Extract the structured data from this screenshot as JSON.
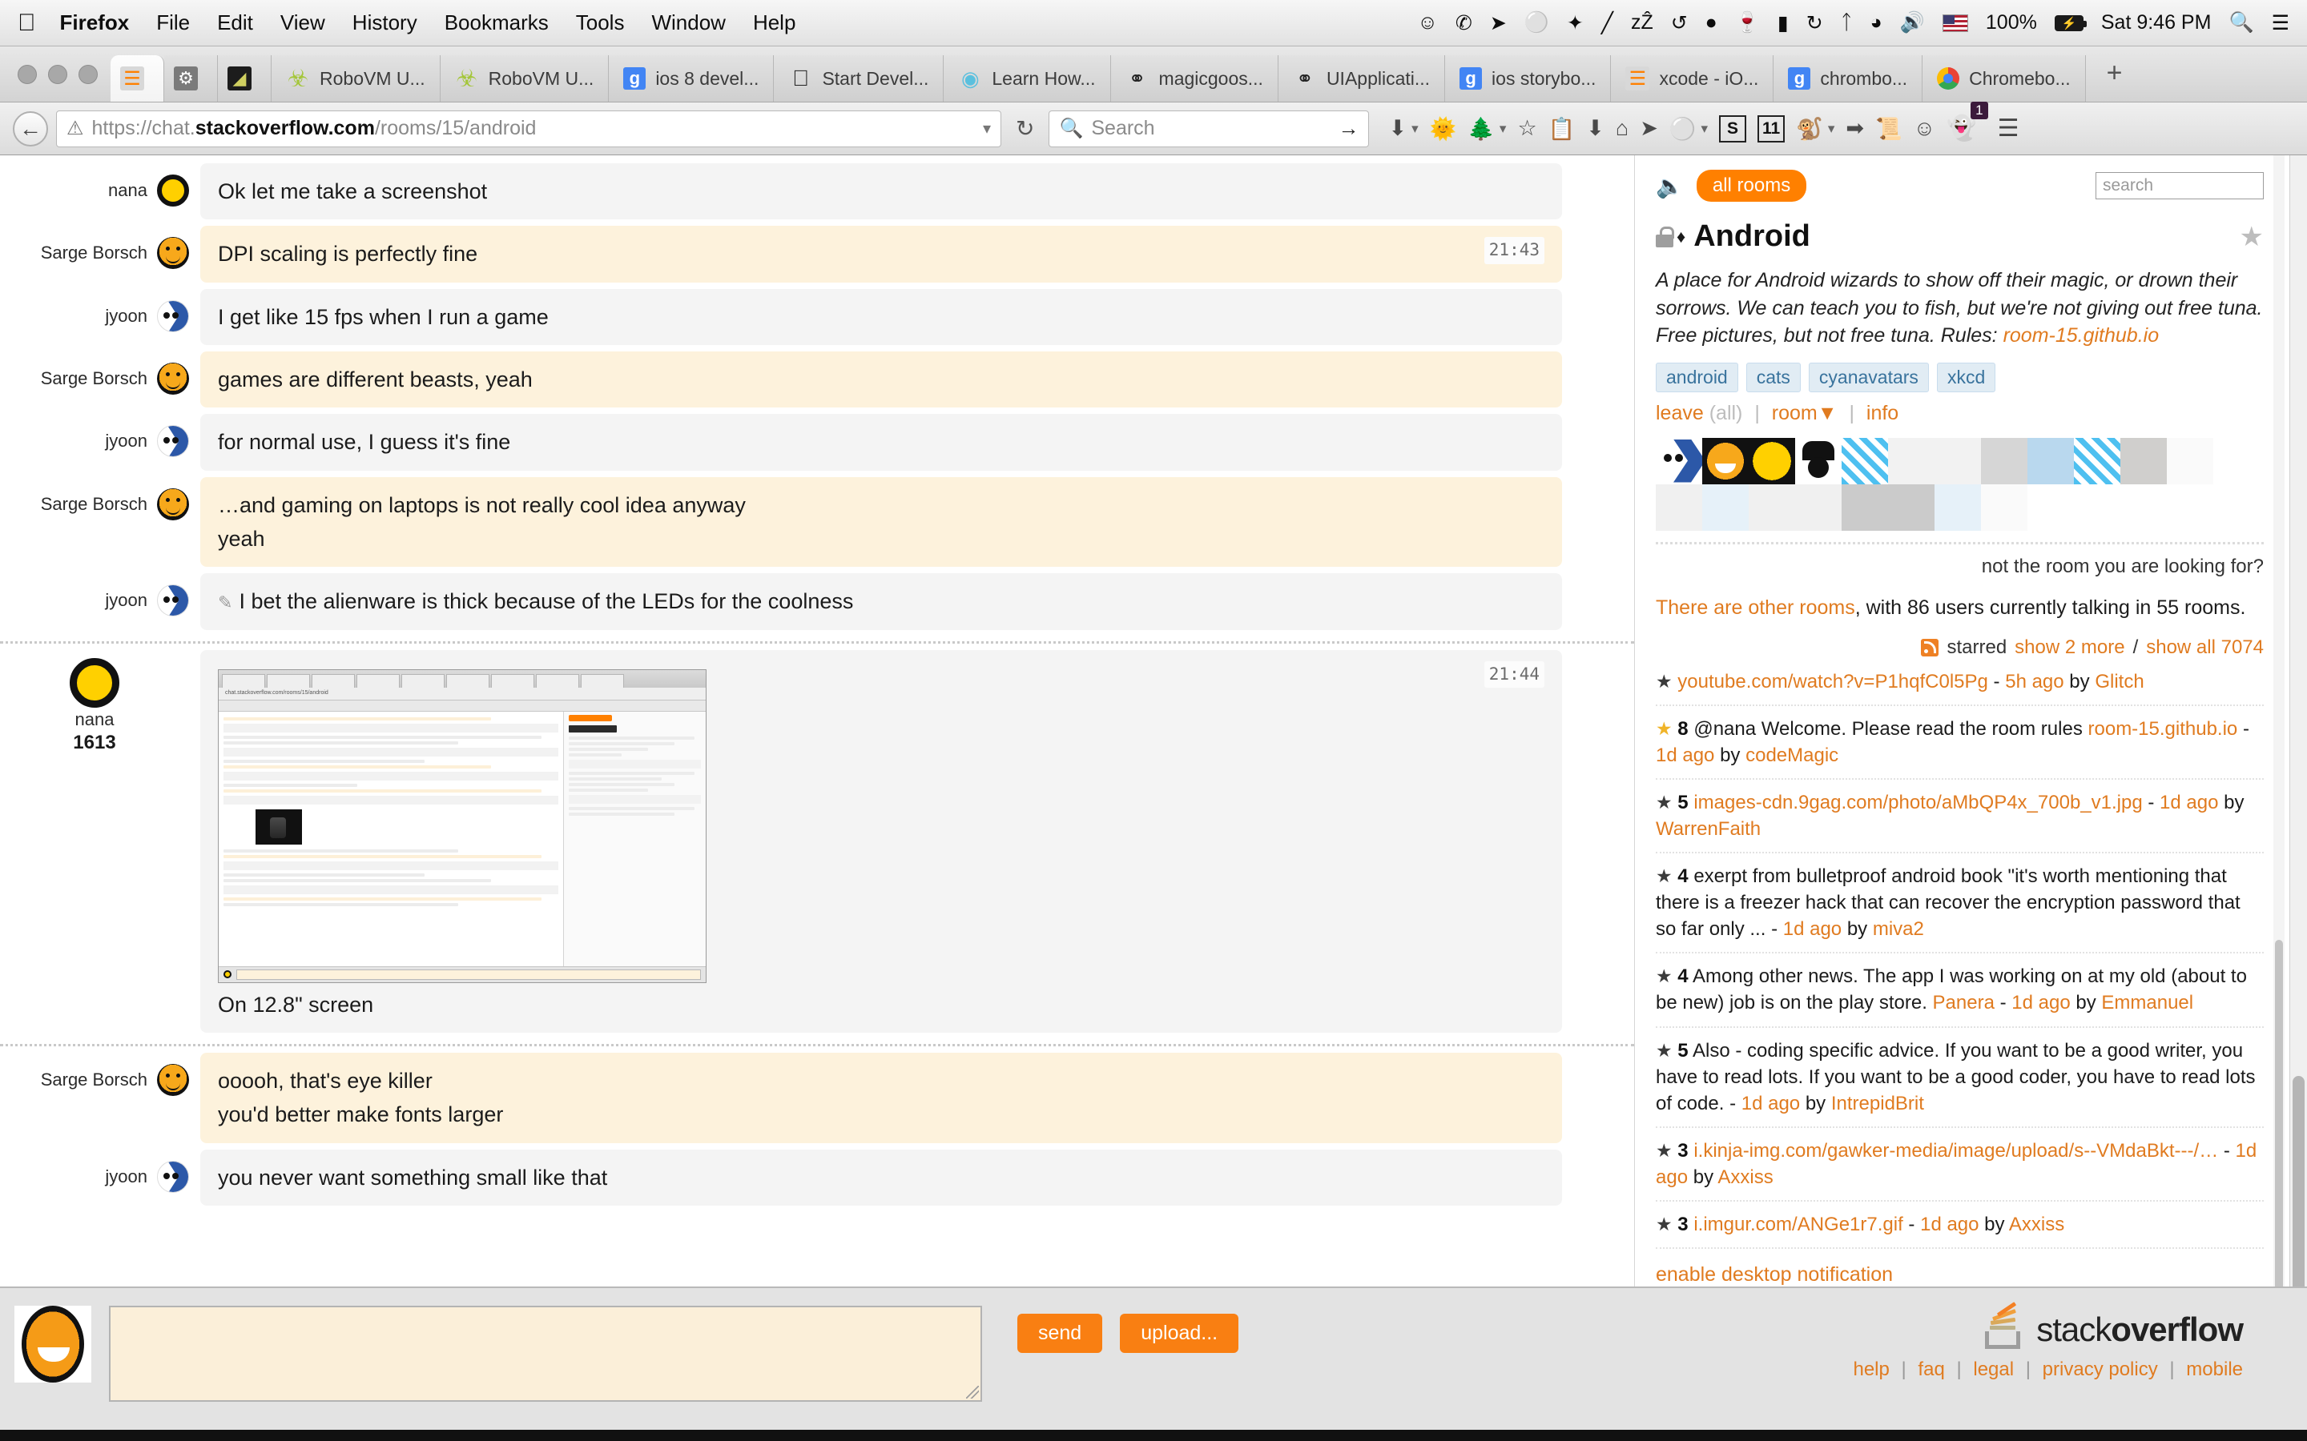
{
  "menubar": {
    "apple": "",
    "items": [
      {
        "label": "Firefox",
        "bold": true
      },
      {
        "label": "File",
        "bold": false
      },
      {
        "label": "Edit",
        "bold": false
      },
      {
        "label": "View",
        "bold": false
      },
      {
        "label": "History",
        "bold": false
      },
      {
        "label": "Bookmarks",
        "bold": false
      },
      {
        "label": "Tools",
        "bold": false
      },
      {
        "label": "Window",
        "bold": false
      },
      {
        "label": "Help",
        "bold": false
      }
    ],
    "status_icons": [
      "person-icon",
      "viber-icon",
      "telegram-icon",
      "emoji-icon",
      "dropbox-icon",
      "slash-icon",
      "sleep-icon",
      "spiral-icon",
      "lock-camera-icon",
      "wine-glass-icon",
      "battery-meter-icon",
      "time-machine-icon",
      "bluetooth-icon",
      "wifi-icon",
      "volume-icon"
    ],
    "flag": "us-flag-icon",
    "battery_percent": "100%",
    "clock": "Sat 9:46 PM",
    "spotlight": "search-icon",
    "notification_center": "list-icon"
  },
  "browser": {
    "tabs": [
      {
        "label": "",
        "favicon": "so",
        "active": true,
        "narrow": true
      },
      {
        "label": "",
        "favicon": "gray",
        "active": false,
        "narrow": true
      },
      {
        "label": "",
        "favicon": "dark",
        "active": false,
        "narrow": true
      },
      {
        "label": "RoboVM U...",
        "favicon": "android",
        "active": false,
        "narrow": false
      },
      {
        "label": "RoboVM U...",
        "favicon": "android",
        "active": false,
        "narrow": false
      },
      {
        "label": "ios 8 devel...",
        "favicon": "google",
        "active": false,
        "narrow": false
      },
      {
        "label": "Start Devel...",
        "favicon": "apple",
        "active": false,
        "narrow": false
      },
      {
        "label": "Learn How...",
        "favicon": "learn",
        "active": false,
        "narrow": false
      },
      {
        "label": "magicgoos...",
        "favicon": "gh",
        "active": false,
        "narrow": false
      },
      {
        "label": "UIApplicati...",
        "favicon": "gh",
        "active": false,
        "narrow": false
      },
      {
        "label": "ios storybo...",
        "favicon": "google",
        "active": false,
        "narrow": false
      },
      {
        "label": "xcode - iO...",
        "favicon": "so",
        "active": false,
        "narrow": false
      },
      {
        "label": "chrombo...",
        "favicon": "google",
        "active": false,
        "narrow": false
      },
      {
        "label": "Chromebo...",
        "favicon": "chrome",
        "active": false,
        "narrow": false
      }
    ],
    "new_tab_label": "+",
    "url": {
      "scheme": "https://chat.",
      "host": "stackoverflow.com",
      "path": "/rooms/15/android"
    },
    "search_placeholder": "Search",
    "zoom_badge": "11",
    "ghost_badge": "1",
    "toolbar_icons": [
      "download-icon",
      "dropdown-caret-icon",
      "weather-icon",
      "tree-icon",
      "dropdown-caret-icon",
      "bookmark-star-icon",
      "reading-list-icon",
      "download-arrow-icon",
      "home-icon",
      "paper-plane-icon",
      "adblock-icon",
      "dropdown-caret-icon",
      "stylish-s-icon",
      "zoom-level-icon",
      "greasemonkey-icon",
      "dropdown-caret-icon",
      "forward-circle-icon",
      "scroll-icon",
      "smiley-icon",
      "ghostery-icon",
      "hamburger-menu-icon"
    ]
  },
  "chat": {
    "messages": [
      {
        "user": "nana",
        "avatar": "nana",
        "tone": "grey",
        "lines": [
          "Ok let me take a screenshot"
        ],
        "timestamp": "",
        "edited": false,
        "separator_before": false,
        "reputation": ""
      },
      {
        "user": "Sarge Borsch",
        "avatar": "sarge",
        "tone": "tan",
        "lines": [
          "DPI scaling is perfectly fine"
        ],
        "timestamp": "21:43",
        "edited": false,
        "separator_before": false,
        "reputation": ""
      },
      {
        "user": "jyoon",
        "avatar": "jyoon",
        "tone": "grey",
        "lines": [
          "I get like 15 fps when I run a game"
        ],
        "timestamp": "",
        "edited": false,
        "separator_before": false,
        "reputation": ""
      },
      {
        "user": "Sarge Borsch",
        "avatar": "sarge",
        "tone": "tan",
        "lines": [
          "games are different beasts, yeah"
        ],
        "timestamp": "",
        "edited": false,
        "separator_before": false,
        "reputation": ""
      },
      {
        "user": "jyoon",
        "avatar": "jyoon",
        "tone": "grey",
        "lines": [
          "for normal use, I guess it's fine"
        ],
        "timestamp": "",
        "edited": false,
        "separator_before": false,
        "reputation": ""
      },
      {
        "user": "Sarge Borsch",
        "avatar": "sarge",
        "tone": "tan",
        "lines": [
          "…and gaming on laptops is not really cool idea anyway",
          "yeah"
        ],
        "timestamp": "",
        "edited": false,
        "separator_before": false,
        "reputation": ""
      },
      {
        "user": "jyoon",
        "avatar": "jyoon",
        "tone": "grey",
        "lines": [
          "I bet the alienware is thick because of the LEDs for the coolness"
        ],
        "timestamp": "",
        "edited": true,
        "separator_before": false,
        "reputation": ""
      },
      {
        "user": "nana",
        "avatar": "nana",
        "tone": "plain",
        "lines": [
          "On 12.8\" screen"
        ],
        "timestamp": "21:44",
        "edited": false,
        "separator_before": true,
        "reputation": "1613",
        "has_image": true
      },
      {
        "user": "Sarge Borsch",
        "avatar": "sarge",
        "tone": "tan",
        "lines": [
          "ooooh, that's eye killer",
          "you'd better make fonts larger"
        ],
        "timestamp": "",
        "edited": false,
        "separator_before": true,
        "reputation": ""
      },
      {
        "user": "jyoon",
        "avatar": "jyoon",
        "tone": "grey",
        "lines": [
          "you never want something small like that"
        ],
        "timestamp": "",
        "edited": false,
        "separator_before": false,
        "reputation": ""
      }
    ]
  },
  "sidebar": {
    "speaker_icon": "speaker-icon",
    "all_rooms_label": "all rooms",
    "search_placeholder": "search",
    "room_name": "Android",
    "room_locked_icon": "lock-icon",
    "room_diamond": "♦",
    "favorite_icon": "star-icon",
    "description": "A place for Android wizards to show off their magic, or drown their sorrows. We can teach you to fish, but we're not giving out free tuna. Free pictures, but not free tuna. Rules: ",
    "description_link": "room-15.github.io",
    "tags": [
      "android",
      "cats",
      "cyanavatars",
      "xkcd"
    ],
    "actions": {
      "leave": "leave",
      "all": "(all)",
      "room": "room▼",
      "info": "info"
    },
    "not_the_room": "not the room you are looking for?",
    "other_rooms_link": "There are other rooms",
    "other_rooms_rest": ", with 86 users currently talking in 55 rooms.",
    "starred_label": "starred",
    "show_more": "show 2 more",
    "show_all": "show all 7074",
    "starred": [
      {
        "glyph": "★",
        "gold": false,
        "count": "",
        "text": "",
        "link": "youtube.com/watch?v=P1hqfC0l5Pg",
        "time": "5h ago",
        "by": "Glitch"
      },
      {
        "glyph": "★",
        "gold": true,
        "count": "8",
        "text": "@nana Welcome. Please read the room rules ",
        "link": "room-15.github.io",
        "time": "1d ago",
        "by": "codeMagic"
      },
      {
        "glyph": "★",
        "gold": false,
        "count": "5",
        "text": "",
        "link": "images-cdn.9gag.com/photo/aMbQP4x_700b_v1.jpg",
        "time": "1d ago",
        "by": "WarrenFaith"
      },
      {
        "glyph": "★",
        "gold": false,
        "count": "4",
        "text": "exerpt from bulletproof android book \"it's worth mentioning that there is a freezer hack that can recover the encryption password that so far only ...",
        "link": "",
        "time": "1d ago",
        "by": "miva2"
      },
      {
        "glyph": "★",
        "gold": false,
        "count": "4",
        "text": "Among other news. The app I was working on at my old (about to be new) job is on the play store. ",
        "link": "Panera",
        "time": "1d ago",
        "by": "Emmanuel"
      },
      {
        "glyph": "★",
        "gold": false,
        "count": "5",
        "text": "Also - coding specific advice. If you want to be a good writer, you have to read lots. If you want to be a good coder, you have to read lots of code.",
        "link": "",
        "time": "1d ago",
        "by": "IntrepidBrit"
      },
      {
        "glyph": "★",
        "gold": false,
        "count": "3",
        "text": "",
        "link": "i.kinja-img.com/gawker-media/image/upload/s--VMdaBkt---/…",
        "time": "1d ago",
        "by": "Axxiss"
      },
      {
        "glyph": "★",
        "gold": false,
        "count": "3",
        "text": "",
        "link": "i.imgur.com/ANGe1r7.gif",
        "time": "1d ago",
        "by": "Axxiss"
      }
    ],
    "enable_notification": "enable desktop notification"
  },
  "composer": {
    "avatar": "troll-face-avatar",
    "value": "",
    "send_label": "send",
    "upload_label": "upload..."
  },
  "footer": {
    "logo_text_light": "stack",
    "logo_text_bold": "overflow",
    "links": [
      "help",
      "faq",
      "legal",
      "privacy policy",
      "mobile"
    ]
  },
  "colors": {
    "accent_orange": "#ff8000",
    "link_orange": "#e07b20",
    "tag_blue": "#39739d",
    "bubble_tan": "#fdf2dc",
    "bubble_grey": "#f4f4f4"
  }
}
